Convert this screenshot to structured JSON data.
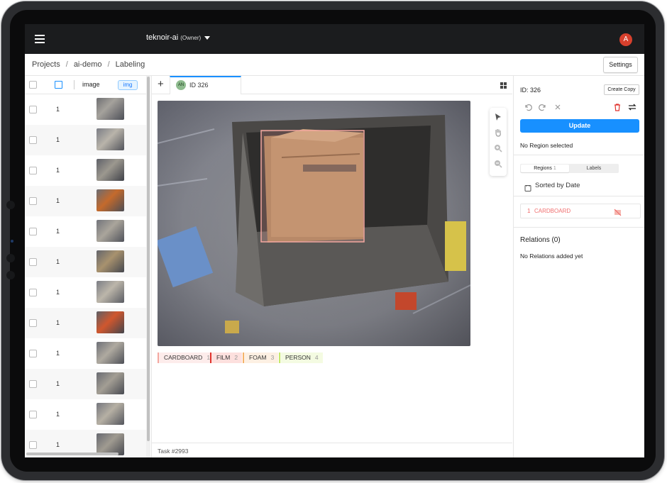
{
  "topbar": {
    "org_name": "teknoir-ai",
    "org_role": "(Owner)",
    "avatar_letter": "A"
  },
  "breadcrumb": {
    "items": [
      "Projects",
      "ai-demo",
      "Labeling"
    ],
    "separator": "/"
  },
  "header": {
    "settings_label": "Settings"
  },
  "list": {
    "column_image": "image",
    "column_tag": "img",
    "rows": [
      {
        "value": "1"
      },
      {
        "value": "1"
      },
      {
        "value": "1"
      },
      {
        "value": "1"
      },
      {
        "value": "1"
      },
      {
        "value": "1"
      },
      {
        "value": "1"
      },
      {
        "value": "1"
      },
      {
        "value": "1"
      },
      {
        "value": "1"
      },
      {
        "value": "1"
      },
      {
        "value": "1"
      }
    ]
  },
  "editor": {
    "tab_avatar": "AN",
    "tab_label": "ID 326",
    "task_label": "Task #2993",
    "labels": [
      {
        "name": "CARDBOARD",
        "hotkey": "1",
        "color": "#f4a7a0"
      },
      {
        "name": "FILM",
        "hotkey": "2",
        "color": "#e0332d"
      },
      {
        "name": "FOAM",
        "hotkey": "3",
        "color": "#f5b36a"
      },
      {
        "name": "PERSON",
        "hotkey": "4",
        "color": "#c5e86c"
      }
    ]
  },
  "side": {
    "id_label": "ID: 326",
    "copy_label": "Create Copy",
    "update_label": "Update",
    "no_region": "No Region selected",
    "tab_regions": "Regions",
    "tab_regions_count": "1",
    "tab_labels": "Labels",
    "sorted_label": "Sorted by Date",
    "region_index": "1",
    "region_label": "CARDBOARD",
    "relations_title": "Relations (0)",
    "relations_empty": "No Relations added yet"
  },
  "colors": {
    "accent": "#1890ff",
    "avatar": "#d7402d",
    "topbar": "#1b1c1e"
  }
}
